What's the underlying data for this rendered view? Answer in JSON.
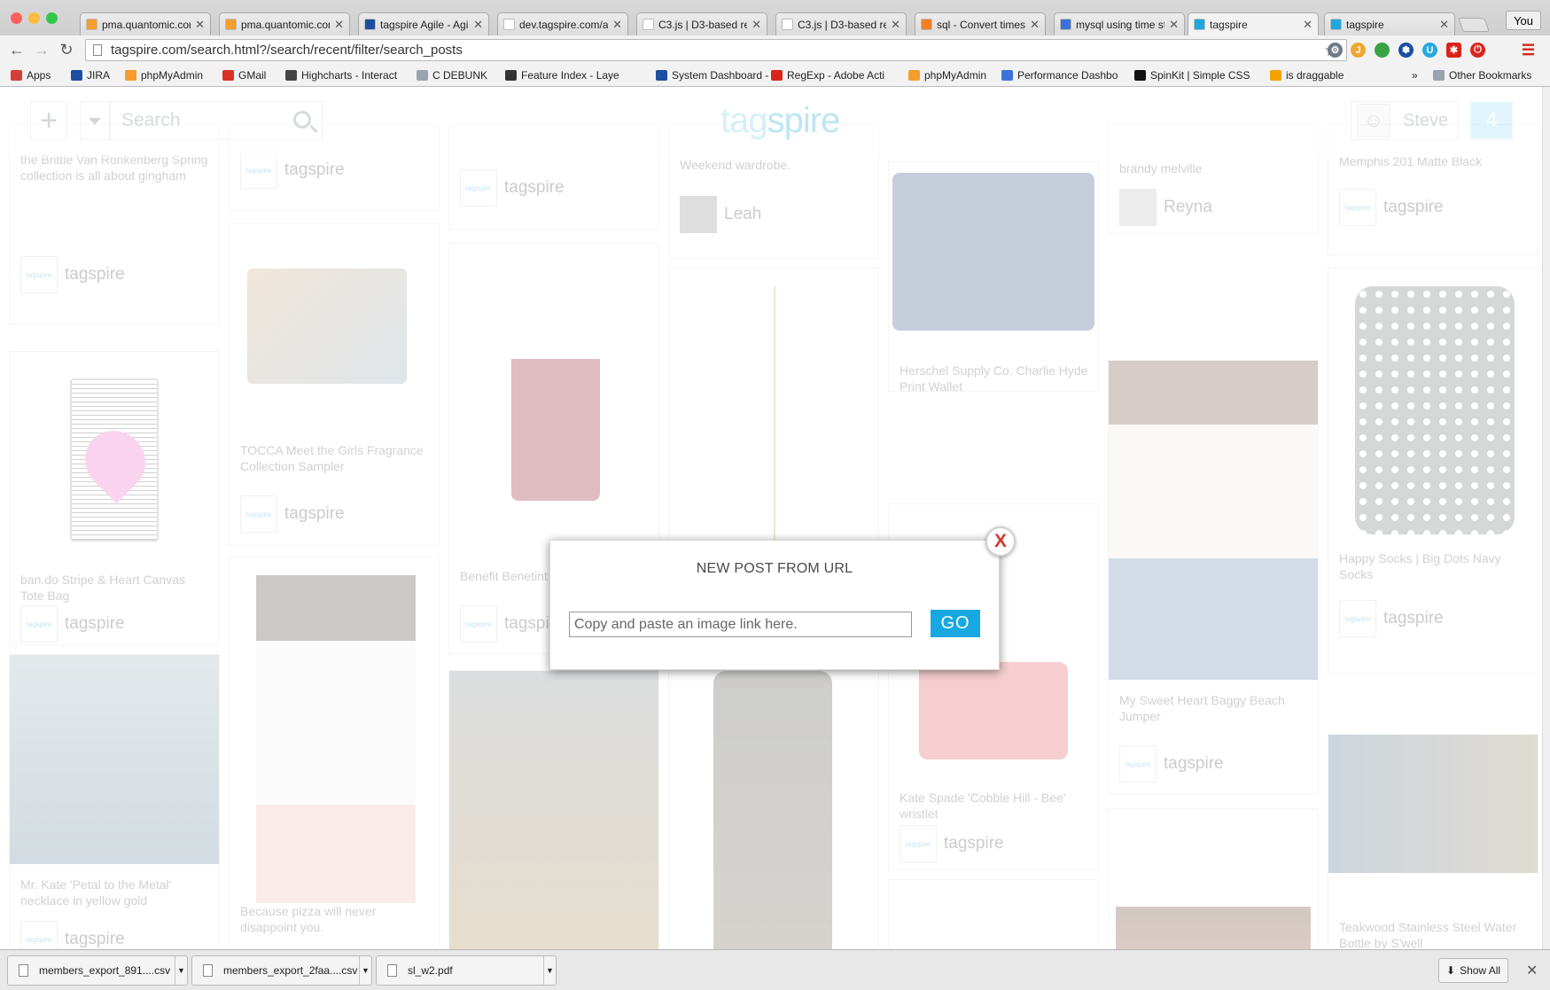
{
  "window": {
    "profile_label": "You",
    "tabs": [
      {
        "label": "pma.quantomic.com",
        "favicon_color": "#f59e2b"
      },
      {
        "label": "pma.quantomic.com",
        "favicon_color": "#f59e2b"
      },
      {
        "label": "tagspire Agile - Agile",
        "favicon_color": "#1d4fa0"
      },
      {
        "label": "dev.tagspire.com/a",
        "favicon_color": "#ffffff"
      },
      {
        "label": "C3.js | D3-based re",
        "favicon_color": "#ffffff"
      },
      {
        "label": "C3.js | D3-based re",
        "favicon_color": "#ffffff"
      },
      {
        "label": "sql - Convert timest",
        "favicon_color": "#f48024"
      },
      {
        "label": "mysql using time st",
        "favicon_color": "#3b72d8"
      },
      {
        "label": "tagspire",
        "favicon_color": "#21a7e0"
      },
      {
        "label": "tagspire",
        "favicon_color": "#21a7e0"
      }
    ]
  },
  "address_bar": {
    "url": "tagspire.com/search.html?/search/recent/filter/search_posts"
  },
  "bookmarks": [
    {
      "label": "Apps",
      "color": "#d43f3a"
    },
    {
      "label": "JIRA",
      "color": "#1d4fa0"
    },
    {
      "label": "phpMyAdmin",
      "color": "#f59e2b"
    },
    {
      "label": "GMail",
      "color": "#d93025"
    },
    {
      "label": "Highcharts - Interact",
      "color": "#444444"
    },
    {
      "label": "C DEBUNK",
      "color": "#9aa3ad"
    },
    {
      "label": "Feature Index - Laye",
      "color": "#333333"
    },
    {
      "label": "System Dashboard -",
      "color": "#1d4fa0"
    },
    {
      "label": "RegExp - Adobe Acti",
      "color": "#d9251c"
    },
    {
      "label": "phpMyAdmin",
      "color": "#f59e2b"
    },
    {
      "label": "Performance Dashbo",
      "color": "#3b72d8"
    },
    {
      "label": "SpinKit | Simple CSS",
      "color": "#111111"
    },
    {
      "label": "is draggable",
      "color": "#f2a300"
    }
  ],
  "bookmarks_overflow": "»",
  "other_bookmarks": "Other Bookmarks",
  "site": {
    "logo_light": "tag",
    "logo_dark": "spire",
    "search_placeholder": "Search",
    "user_name": "Steve",
    "notification_count": "4",
    "add_symbol": "+"
  },
  "feed": [
    {
      "caption": "the Brittle Van Ronkenberg Spring collection is all about gingham",
      "source": "tagspire"
    },
    {
      "caption": "",
      "source": "tagspire"
    },
    {
      "caption": "",
      "source": "tagspire"
    },
    {
      "caption": "Weekend wardrobe.",
      "source": "Leah"
    },
    {
      "caption": "",
      "source": ""
    },
    {
      "caption": "brandy melville",
      "source": "Reyna"
    },
    {
      "caption": "Memphis 201 Matte Black",
      "source": "tagspire"
    },
    {
      "caption": "ban.do Stripe & Heart Canvas Tote Bag",
      "source": "tagspire"
    },
    {
      "caption": "TOCCA Meet the Girls Fragrance Collection Sampler",
      "source": "tagspire"
    },
    {
      "caption": "Benefit Benetint",
      "source": "tagspire"
    },
    {
      "caption": "",
      "source": "tagspire"
    },
    {
      "caption": "Herschel Supply Co. Charlie Hyde Print Wallet",
      "source": ""
    },
    {
      "caption": "My Sweet Heart Baggy Beach Jumper",
      "source": "tagspire"
    },
    {
      "caption": "Happy Socks | Big Dots Navy Socks",
      "source": "tagspire"
    },
    {
      "caption": "Mr. Kate 'Petal to the Metal' necklace in yellow gold",
      "source": "tagspire"
    },
    {
      "caption": "Because pizza will never disappoint you.",
      "source": ""
    },
    {
      "caption": "Kate Spade 'Cobble Hill - Bee' wristlet",
      "source": "tagspire"
    },
    {
      "caption": "Teakwood Stainless Steel Water Bottle by S'well",
      "source": "tagspire"
    }
  ],
  "modal": {
    "title": "NEW POST FROM URL",
    "input_placeholder": "Copy and paste an image link here.",
    "input_value": "",
    "go_label": "GO",
    "close_label": "X"
  },
  "downloads": [
    {
      "name": "members_export_891....csv"
    },
    {
      "name": "members_export_2faa....csv"
    },
    {
      "name": "sl_w2.pdf"
    }
  ],
  "show_all_label": "Show All"
}
